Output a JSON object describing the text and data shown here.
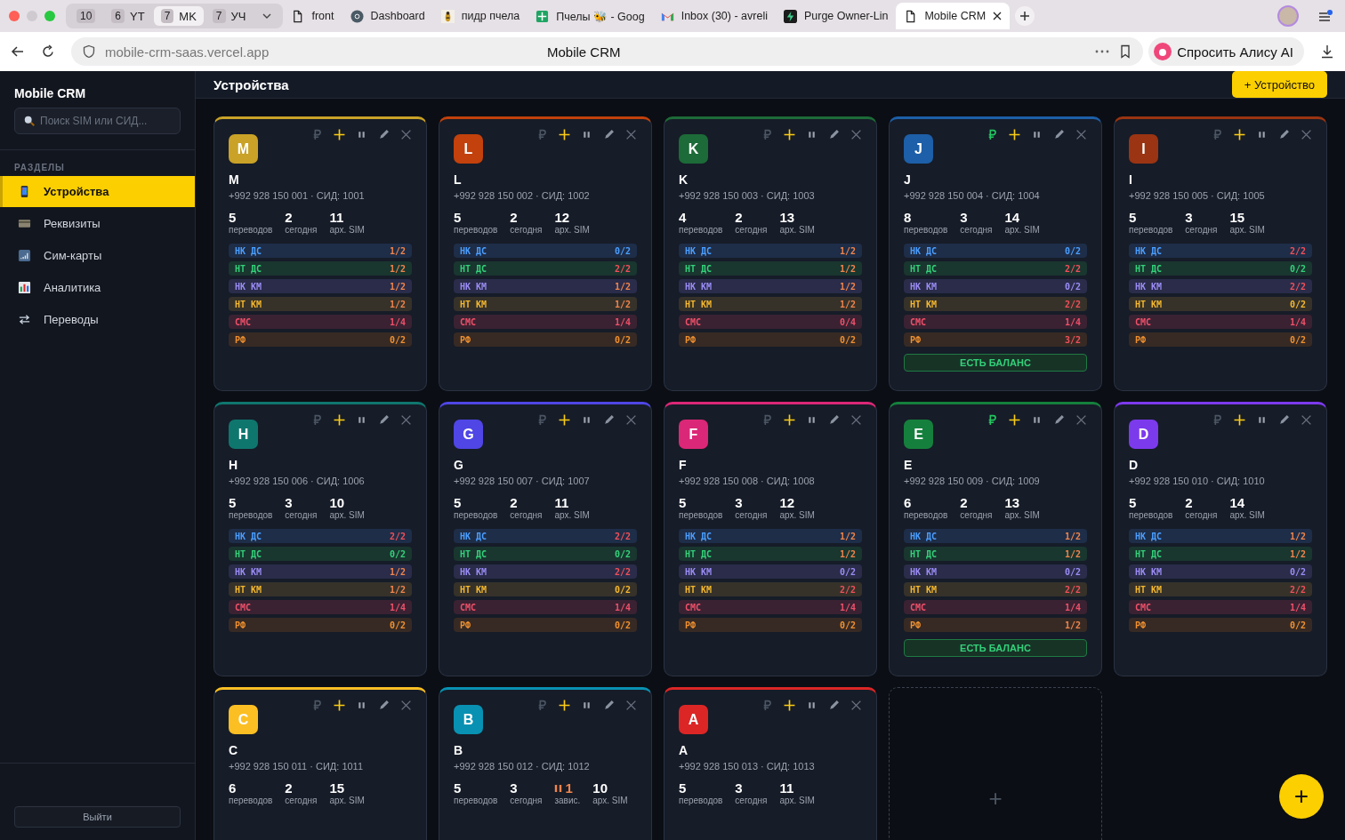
{
  "browser": {
    "tab_groups": [
      {
        "count": "10",
        "selected": false
      },
      {
        "count": "6",
        "label": "YT",
        "selected": false
      },
      {
        "count": "7",
        "label": "MK",
        "selected": true
      },
      {
        "count": "7",
        "label": "УЧ",
        "selected": false
      }
    ],
    "tabs": [
      {
        "title": "front",
        "selected": false
      },
      {
        "title": "Dashboard",
        "selected": false
      },
      {
        "title": "пидр пчела",
        "selected": false
      },
      {
        "title": "Пчелы 🐝 - Goog",
        "selected": false
      },
      {
        "title": "Inbox (30) - avreli",
        "selected": false
      },
      {
        "title": "Purge Owner-Lin",
        "selected": false
      },
      {
        "title": "Mobile CRM",
        "selected": true
      }
    ],
    "url": "mobile-crm-saas.vercel.app",
    "page_title": "Mobile CRM",
    "assistant_button": "Спросить Алису AI"
  },
  "sidebar": {
    "brand": "Mobile CRM",
    "search_placeholder": "Поиск SIM или СИД...",
    "section_label": "РАЗДЕЛЫ",
    "items": [
      {
        "label": "Устройства",
        "selected": true
      },
      {
        "label": "Реквизиты",
        "selected": false
      },
      {
        "label": "Сим-карты",
        "selected": false
      },
      {
        "label": "Аналитика",
        "selected": false
      },
      {
        "label": "Переводы",
        "selected": false
      }
    ],
    "logout": "Выйти"
  },
  "header": {
    "title": "Устройства",
    "add_button": "+ Устройство"
  },
  "devices": [
    {
      "letter": "M",
      "name": "M",
      "color": "#c9a227",
      "phone": "+992 928 150 001 · СИД: 1001",
      "balance": false,
      "stats": [
        {
          "value": "5",
          "label": "переводов"
        },
        {
          "value": "2",
          "label": "сегодня"
        },
        {
          "value": "11",
          "label": "арх. SIM"
        }
      ],
      "slots": [
        {
          "kind": "nk_ds",
          "label": "НК ДС",
          "value": "1/2",
          "partial": true,
          "full": false
        },
        {
          "kind": "nt_ds",
          "label": "НТ ДС",
          "value": "1/2",
          "partial": true,
          "full": false
        },
        {
          "kind": "nk_km",
          "label": "НК КМ",
          "value": "1/2",
          "partial": true,
          "full": false
        },
        {
          "kind": "nt_km",
          "label": "НТ КМ",
          "value": "1/2",
          "partial": true,
          "full": false
        },
        {
          "kind": "sms",
          "label": "СМС",
          "value": "1/4",
          "partial": false,
          "full": false
        },
        {
          "kind": "rf",
          "label": "РФ",
          "value": "0/2",
          "partial": false,
          "full": false
        }
      ]
    },
    {
      "letter": "L",
      "name": "L",
      "color": "#c2410c",
      "phone": "+992 928 150 002 · СИД: 1002",
      "balance": false,
      "stats": [
        {
          "value": "5",
          "label": "переводов"
        },
        {
          "value": "2",
          "label": "сегодня"
        },
        {
          "value": "12",
          "label": "арх. SIM"
        }
      ],
      "slots": [
        {
          "kind": "nk_ds",
          "label": "НК ДС",
          "value": "0/2",
          "partial": false,
          "full": false
        },
        {
          "kind": "nt_ds",
          "label": "НТ ДС",
          "value": "2/2",
          "full": true
        },
        {
          "kind": "nk_km",
          "label": "НК КМ",
          "value": "1/2",
          "partial": true,
          "full": false
        },
        {
          "kind": "nt_km",
          "label": "НТ КМ",
          "value": "1/2",
          "partial": true,
          "full": false
        },
        {
          "kind": "sms",
          "label": "СМС",
          "value": "1/4",
          "partial": false,
          "full": false
        },
        {
          "kind": "rf",
          "label": "РФ",
          "value": "0/2",
          "partial": false,
          "full": false
        }
      ]
    },
    {
      "letter": "K",
      "name": "K",
      "color": "#1d6b38",
      "phone": "+992 928 150 003 · СИД: 1003",
      "balance": false,
      "stats": [
        {
          "value": "4",
          "label": "переводов"
        },
        {
          "value": "2",
          "label": "сегодня"
        },
        {
          "value": "13",
          "label": "арх. SIM"
        }
      ],
      "slots": [
        {
          "kind": "nk_ds",
          "label": "НК ДС",
          "value": "1/2",
          "partial": true,
          "full": false
        },
        {
          "kind": "nt_ds",
          "label": "НТ ДС",
          "value": "1/2",
          "partial": true,
          "full": false
        },
        {
          "kind": "nk_km",
          "label": "НК КМ",
          "value": "1/2",
          "partial": true,
          "full": false
        },
        {
          "kind": "nt_km",
          "label": "НТ КМ",
          "value": "1/2",
          "partial": true,
          "full": false
        },
        {
          "kind": "sms",
          "label": "СМС",
          "value": "0/4",
          "partial": false,
          "full": false
        },
        {
          "kind": "rf",
          "label": "РФ",
          "value": "0/2",
          "partial": false,
          "full": false
        }
      ]
    },
    {
      "letter": "J",
      "name": "J",
      "color": "#1d5fa8",
      "phone": "+992 928 150 004 · СИД: 1004",
      "balance": true,
      "stats": [
        {
          "value": "8",
          "label": "переводов"
        },
        {
          "value": "3",
          "label": "сегодня"
        },
        {
          "value": "14",
          "label": "арх. SIM"
        }
      ],
      "slots": [
        {
          "kind": "nk_ds",
          "label": "НК ДС",
          "value": "0/2",
          "partial": false,
          "full": false
        },
        {
          "kind": "nt_ds",
          "label": "НТ ДС",
          "value": "2/2",
          "full": true
        },
        {
          "kind": "nk_km",
          "label": "НК КМ",
          "value": "0/2",
          "partial": false,
          "full": false
        },
        {
          "kind": "nt_km",
          "label": "НТ КМ",
          "value": "2/2",
          "full": true
        },
        {
          "kind": "sms",
          "label": "СМС",
          "value": "1/4",
          "partial": false,
          "full": false
        },
        {
          "kind": "rf",
          "label": "РФ",
          "value": "3/2",
          "full": true
        }
      ],
      "balance_badge": "ЕСТЬ БАЛАНС"
    },
    {
      "letter": "I",
      "name": "I",
      "color": "#9a3412",
      "phone": "+992 928 150 005 · СИД: 1005",
      "balance": false,
      "stats": [
        {
          "value": "5",
          "label": "переводов"
        },
        {
          "value": "3",
          "label": "сегодня"
        },
        {
          "value": "15",
          "label": "арх. SIM"
        }
      ],
      "slots": [
        {
          "kind": "nk_ds",
          "label": "НК ДС",
          "value": "2/2",
          "full": true
        },
        {
          "kind": "nt_ds",
          "label": "НТ ДС",
          "value": "0/2",
          "partial": false,
          "full": false
        },
        {
          "kind": "nk_km",
          "label": "НК КМ",
          "value": "2/2",
          "full": true
        },
        {
          "kind": "nt_km",
          "label": "НТ КМ",
          "value": "0/2",
          "partial": false,
          "full": false
        },
        {
          "kind": "sms",
          "label": "СМС",
          "value": "1/4",
          "partial": false,
          "full": false
        },
        {
          "kind": "rf",
          "label": "РФ",
          "value": "0/2",
          "partial": false,
          "full": false
        }
      ]
    },
    {
      "letter": "H",
      "name": "H",
      "color": "#0f766e",
      "phone": "+992 928 150 006 · СИД: 1006",
      "balance": false,
      "stats": [
        {
          "value": "5",
          "label": "переводов"
        },
        {
          "value": "3",
          "label": "сегодня"
        },
        {
          "value": "10",
          "label": "арх. SIM"
        }
      ],
      "slots": [
        {
          "kind": "nk_ds",
          "label": "НК ДС",
          "value": "2/2",
          "full": true
        },
        {
          "kind": "nt_ds",
          "label": "НТ ДС",
          "value": "0/2",
          "partial": false,
          "full": false
        },
        {
          "kind": "nk_km",
          "label": "НК КМ",
          "value": "1/2",
          "partial": true,
          "full": false
        },
        {
          "kind": "nt_km",
          "label": "НТ КМ",
          "value": "1/2",
          "partial": true,
          "full": false
        },
        {
          "kind": "sms",
          "label": "СМС",
          "value": "1/4",
          "partial": false,
          "full": false
        },
        {
          "kind": "rf",
          "label": "РФ",
          "value": "0/2",
          "partial": false,
          "full": false
        }
      ]
    },
    {
      "letter": "G",
      "name": "G",
      "color": "#4f46e5",
      "phone": "+992 928 150 007 · СИД: 1007",
      "balance": false,
      "stats": [
        {
          "value": "5",
          "label": "переводов"
        },
        {
          "value": "2",
          "label": "сегодня"
        },
        {
          "value": "11",
          "label": "арх. SIM"
        }
      ],
      "slots": [
        {
          "kind": "nk_ds",
          "label": "НК ДС",
          "value": "2/2",
          "full": true
        },
        {
          "kind": "nt_ds",
          "label": "НТ ДС",
          "value": "0/2",
          "partial": false,
          "full": false
        },
        {
          "kind": "nk_km",
          "label": "НК КМ",
          "value": "2/2",
          "full": true
        },
        {
          "kind": "nt_km",
          "label": "НТ КМ",
          "value": "0/2",
          "partial": false,
          "full": false
        },
        {
          "kind": "sms",
          "label": "СМС",
          "value": "1/4",
          "partial": false,
          "full": false
        },
        {
          "kind": "rf",
          "label": "РФ",
          "value": "0/2",
          "partial": false,
          "full": false
        }
      ]
    },
    {
      "letter": "F",
      "name": "F",
      "color": "#db2777",
      "phone": "+992 928 150 008 · СИД: 1008",
      "balance": false,
      "stats": [
        {
          "value": "5",
          "label": "переводов"
        },
        {
          "value": "3",
          "label": "сегодня"
        },
        {
          "value": "12",
          "label": "арх. SIM"
        }
      ],
      "slots": [
        {
          "kind": "nk_ds",
          "label": "НК ДС",
          "value": "1/2",
          "partial": true,
          "full": false
        },
        {
          "kind": "nt_ds",
          "label": "НТ ДС",
          "value": "1/2",
          "partial": true,
          "full": false
        },
        {
          "kind": "nk_km",
          "label": "НК КМ",
          "value": "0/2",
          "partial": false,
          "full": false
        },
        {
          "kind": "nt_km",
          "label": "НТ КМ",
          "value": "2/2",
          "full": true
        },
        {
          "kind": "sms",
          "label": "СМС",
          "value": "1/4",
          "partial": false,
          "full": false
        },
        {
          "kind": "rf",
          "label": "РФ",
          "value": "0/2",
          "partial": false,
          "full": false
        }
      ]
    },
    {
      "letter": "E",
      "name": "E",
      "color": "#15803d",
      "phone": "+992 928 150 009 · СИД: 1009",
      "balance": true,
      "stats": [
        {
          "value": "6",
          "label": "переводов"
        },
        {
          "value": "2",
          "label": "сегодня"
        },
        {
          "value": "13",
          "label": "арх. SIM"
        }
      ],
      "slots": [
        {
          "kind": "nk_ds",
          "label": "НК ДС",
          "value": "1/2",
          "partial": true,
          "full": false
        },
        {
          "kind": "nt_ds",
          "label": "НТ ДС",
          "value": "1/2",
          "partial": true,
          "full": false
        },
        {
          "kind": "nk_km",
          "label": "НК КМ",
          "value": "0/2",
          "partial": false,
          "full": false
        },
        {
          "kind": "nt_km",
          "label": "НТ КМ",
          "value": "2/2",
          "full": true
        },
        {
          "kind": "sms",
          "label": "СМС",
          "value": "1/4",
          "partial": false,
          "full": false
        },
        {
          "kind": "rf",
          "label": "РФ",
          "value": "1/2",
          "partial": true,
          "full": false
        }
      ],
      "balance_badge": "ЕСТЬ БАЛАНС"
    },
    {
      "letter": "D",
      "name": "D",
      "color": "#7c3aed",
      "phone": "+992 928 150 010 · СИД: 1010",
      "balance": false,
      "stats": [
        {
          "value": "5",
          "label": "переводов"
        },
        {
          "value": "2",
          "label": "сегодня"
        },
        {
          "value": "14",
          "label": "арх. SIM"
        }
      ],
      "slots": [
        {
          "kind": "nk_ds",
          "label": "НК ДС",
          "value": "1/2",
          "partial": true,
          "full": false
        },
        {
          "kind": "nt_ds",
          "label": "НТ ДС",
          "value": "1/2",
          "partial": true,
          "full": false
        },
        {
          "kind": "nk_km",
          "label": "НК КМ",
          "value": "0/2",
          "partial": false,
          "full": false
        },
        {
          "kind": "nt_km",
          "label": "НТ КМ",
          "value": "2/2",
          "full": true
        },
        {
          "kind": "sms",
          "label": "СМС",
          "value": "1/4",
          "partial": false,
          "full": false
        },
        {
          "kind": "rf",
          "label": "РФ",
          "value": "0/2",
          "partial": false,
          "full": false
        }
      ]
    },
    {
      "letter": "C",
      "name": "C",
      "color": "#fbbf24",
      "phone": "+992 928 150 011 · СИД: 1011",
      "balance": false,
      "stats": [
        {
          "value": "6",
          "label": "переводов"
        },
        {
          "value": "2",
          "label": "сегодня"
        },
        {
          "value": "15",
          "label": "арх. SIM"
        }
      ]
    },
    {
      "letter": "B",
      "name": "B",
      "color": "#0891b2",
      "phone": "+992 928 150 012 · СИД: 1012",
      "balance": false,
      "stats": [
        {
          "value": "5",
          "label": "переводов"
        },
        {
          "value": "3",
          "label": "сегодня"
        },
        {
          "value": "1",
          "label": "завис.",
          "kind": "hung"
        },
        {
          "value": "10",
          "label": "арх. SIM"
        }
      ]
    },
    {
      "letter": "A",
      "name": "A",
      "color": "#dc2626",
      "phone": "+992 928 150 013 · СИД: 1013",
      "balance": false,
      "stats": [
        {
          "value": "5",
          "label": "переводов"
        },
        {
          "value": "3",
          "label": "сегодня"
        },
        {
          "value": "11",
          "label": "арх. SIM"
        }
      ]
    }
  ],
  "add_card": {
    "symbol": "+"
  },
  "fab": {
    "symbol": "+"
  }
}
